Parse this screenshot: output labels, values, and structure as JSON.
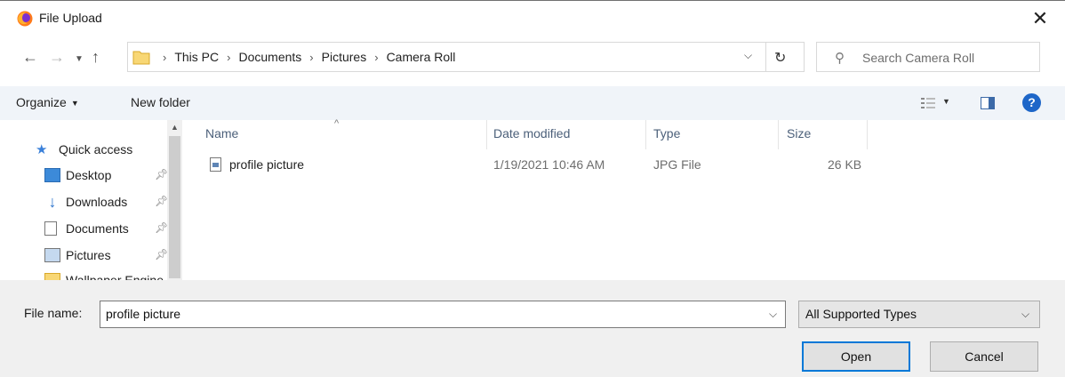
{
  "window": {
    "title": "File Upload",
    "close_glyph": "✕"
  },
  "address": {
    "crumbs": [
      "This PC",
      "Documents",
      "Pictures",
      "Camera Roll"
    ],
    "search_placeholder": "Search Camera Roll"
  },
  "toolbar": {
    "organize_label": "Organize",
    "new_folder_label": "New folder"
  },
  "navpane": {
    "quick_access": "Quick access",
    "items": [
      {
        "label": "Desktop",
        "icon": "desktop-icon"
      },
      {
        "label": "Downloads",
        "icon": "downloads-icon"
      },
      {
        "label": "Documents",
        "icon": "documents-icon"
      },
      {
        "label": "Pictures",
        "icon": "pictures-icon"
      },
      {
        "label": "Wallpaper Engine",
        "icon": "folder-icon"
      }
    ]
  },
  "filelist": {
    "columns": [
      "Name",
      "Date modified",
      "Type",
      "Size"
    ],
    "rows": [
      {
        "name": "profile picture",
        "date": "1/19/2021 10:46 AM",
        "type": "JPG File",
        "size": "26 KB"
      }
    ]
  },
  "bottom": {
    "filename_label": "File name:",
    "filename_value": "profile picture",
    "filetype_value": "All Supported Types",
    "open_label": "Open",
    "cancel_label": "Cancel"
  },
  "colors": {
    "accent": "#0078d7",
    "toolbar_bg": "#f0f4f9",
    "help_blue": "#1e66c8"
  }
}
